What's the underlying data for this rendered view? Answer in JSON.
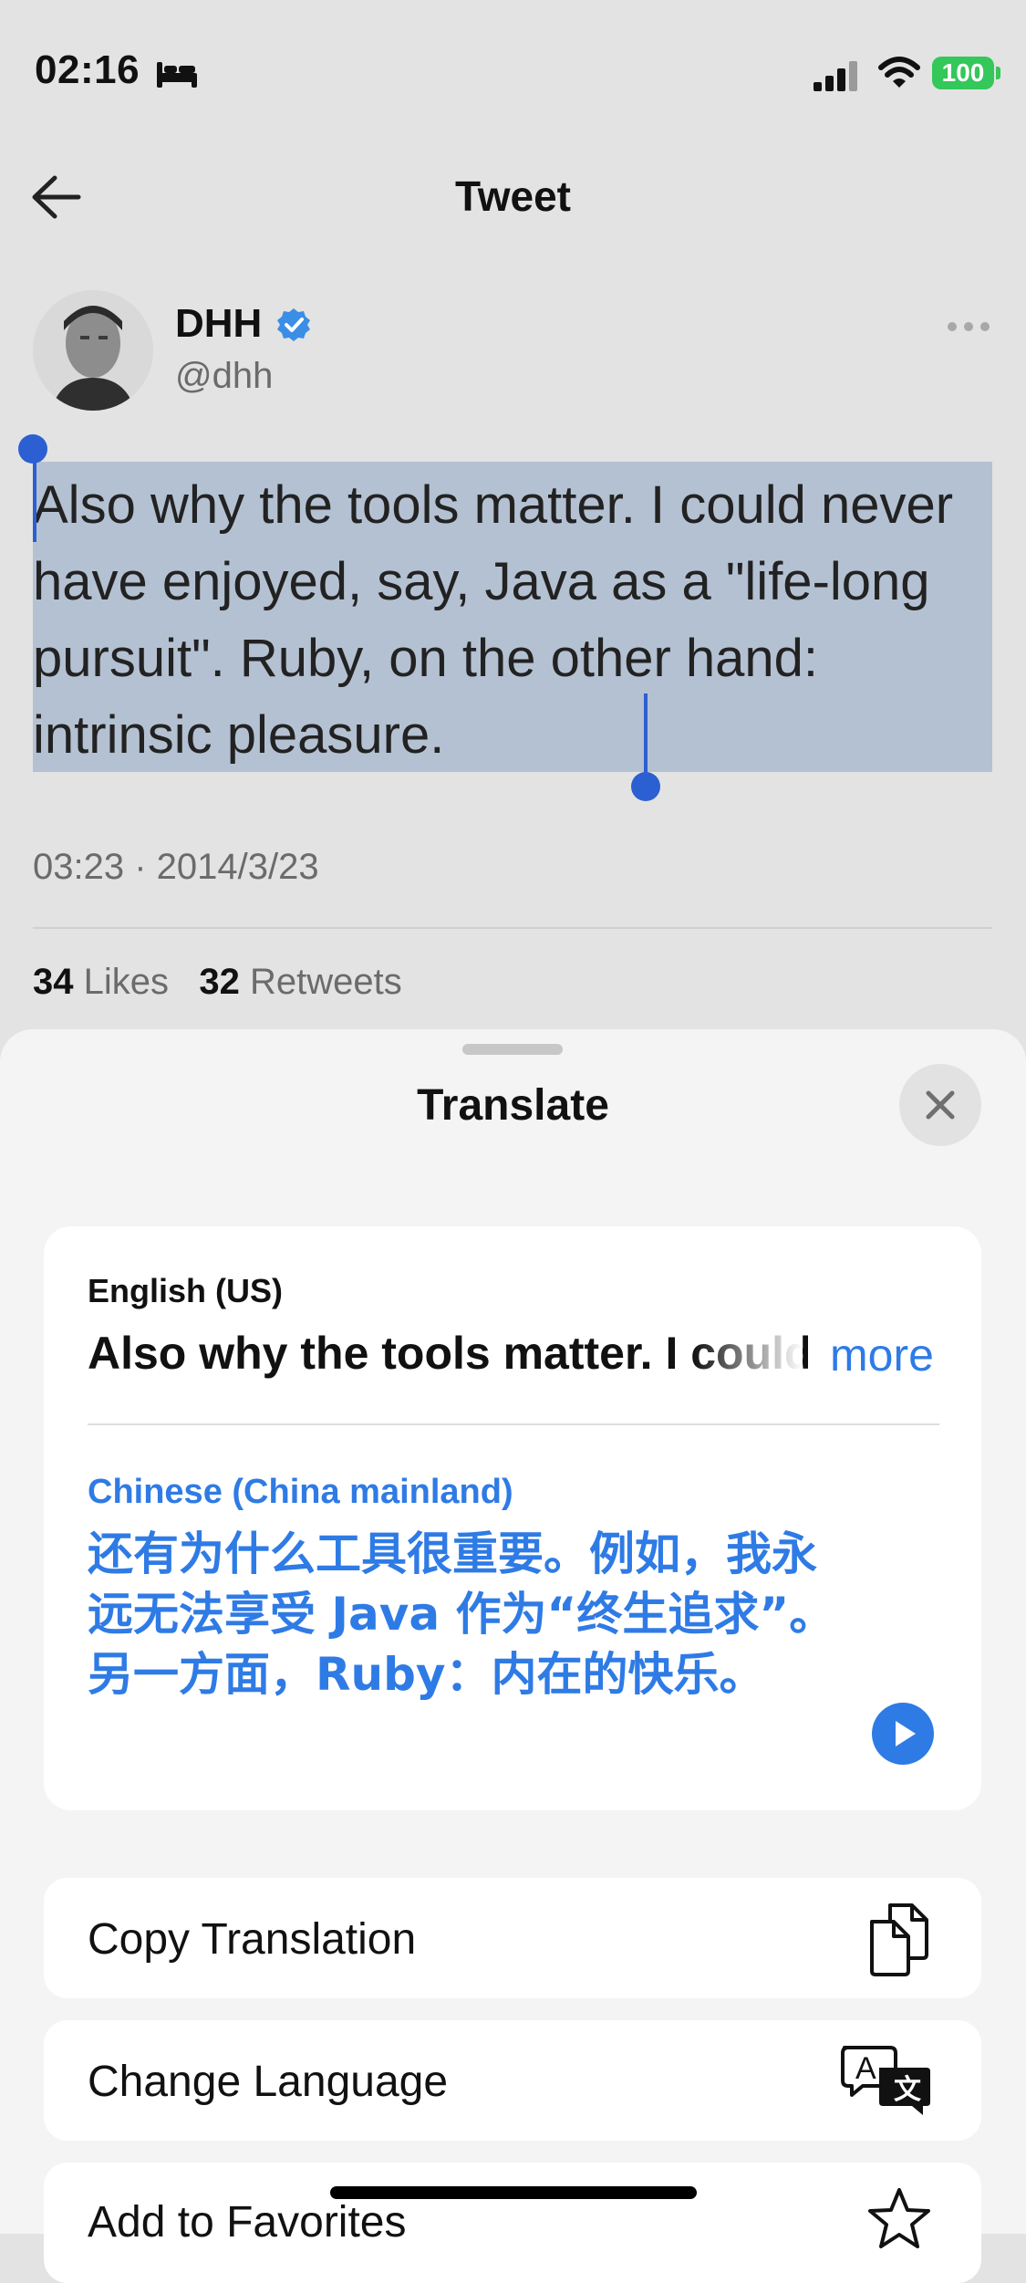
{
  "status_bar": {
    "time": "02:16",
    "battery": "100"
  },
  "header": {
    "title": "Tweet"
  },
  "author": {
    "name": "DHH",
    "handle": "@dhh"
  },
  "tweet": {
    "text": "Also why the tools matter. I could never have enjoyed, say, Java as a \"life-long pursuit\". Ruby, on the other hand: intrinsic pleasure.",
    "meta": "03:23 · 2014/3/23",
    "likes_count": "34",
    "likes_label": "Likes",
    "retweets_count": "32",
    "retweets_label": "Retweets"
  },
  "translate_sheet": {
    "title": "Translate",
    "source_language": "English (US)",
    "source_text": "Also why the tools matter. I could never have enjoyed, say, Java as a \"life-long pursuit\".",
    "more_label": "more",
    "target_language": "Chinese (China mainland)",
    "target_text": "还有为什么工具很重要。例如，我永远无法享受 Java 作为“终生追求”。另一方面，Ruby：内在的快乐。",
    "actions": [
      {
        "label": "Copy Translation"
      },
      {
        "label": "Change Language"
      },
      {
        "label": "Add to Favorites"
      }
    ]
  },
  "colors": {
    "accent": "#2f7be5",
    "selection": "#b4c1d2",
    "handle": "#2c5fd1"
  }
}
